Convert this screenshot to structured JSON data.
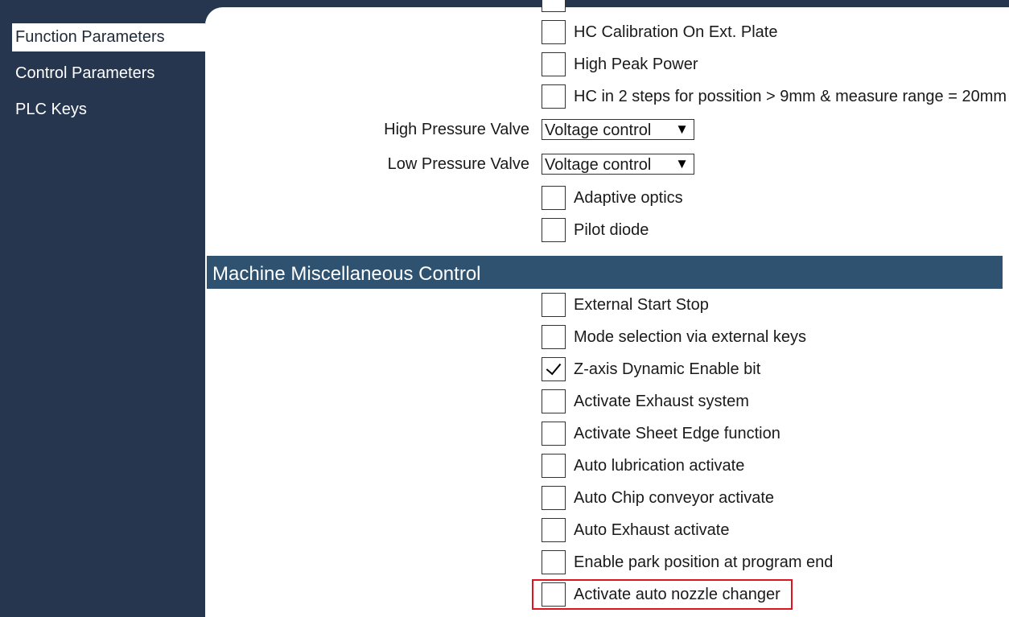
{
  "sidebar": {
    "items": [
      {
        "label": "Function Parameters",
        "active": true
      },
      {
        "label": "Control Parameters",
        "active": false
      },
      {
        "label": "PLC Keys",
        "active": false
      }
    ]
  },
  "laser_section": {
    "checkboxes_top": [
      {
        "label": "",
        "checked": false
      },
      {
        "label": "HC Calibration On Ext. Plate",
        "checked": false
      },
      {
        "label": "High Peak Power",
        "checked": false
      },
      {
        "label": "HC in 2 steps for possition > 9mm & measure range = 20mm",
        "checked": false
      }
    ],
    "high_pressure_valve": {
      "label": "High Pressure Valve",
      "value": "Voltage control"
    },
    "low_pressure_valve": {
      "label": "Low Pressure Valve",
      "value": "Voltage control"
    },
    "checkboxes_bottom": [
      {
        "label": "Adaptive optics",
        "checked": false
      },
      {
        "label": "Pilot diode",
        "checked": false
      }
    ]
  },
  "misc_section": {
    "title": "Machine Miscellaneous Control",
    "checkboxes": [
      {
        "label": "External Start Stop",
        "checked": false
      },
      {
        "label": "Mode selection via external keys",
        "checked": false
      },
      {
        "label": "Z-axis Dynamic Enable bit",
        "checked": true
      },
      {
        "label": "Activate Exhaust system",
        "checked": false
      },
      {
        "label": "Activate Sheet Edge function",
        "checked": false
      },
      {
        "label": "Auto lubrication activate",
        "checked": false
      },
      {
        "label": "Auto Chip conveyor activate",
        "checked": false
      },
      {
        "label": "Auto Exhaust activate",
        "checked": false
      },
      {
        "label": "Enable park position at program end",
        "checked": false
      },
      {
        "label": "Activate auto nozzle changer",
        "checked": false,
        "highlighted": true
      }
    ]
  },
  "icons": {
    "dropdown_arrow": "▼",
    "check": "checkmark-icon"
  },
  "colors": {
    "sidebar_bg": "#25364e",
    "section_header_bg": "#2e5270",
    "highlight_border": "#e0141e"
  }
}
